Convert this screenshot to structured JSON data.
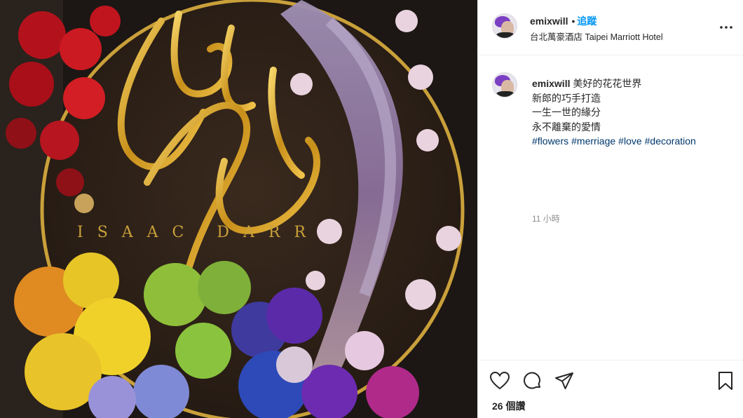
{
  "post": {
    "photo_sign_script": "Chen Chen",
    "photo_sign_caps": "ISAAC DARR"
  },
  "header": {
    "username": "emixwill",
    "separator": "•",
    "follow_label": "追蹤",
    "location": "台北萬豪酒店 Taipei Marriott Hotel"
  },
  "caption": {
    "username": "emixwill",
    "first_line": "美好的花花世界",
    "lines": [
      "新郎的巧手打造",
      "一生一世的緣分",
      "永不離棄的愛情"
    ],
    "hashtags": [
      "#flowers",
      "#merriage",
      "#love",
      "#decoration"
    ],
    "timestamp": "11 小時"
  },
  "actions": {
    "likes": "26 個讚"
  },
  "colors": {
    "link_blue": "#0095f6",
    "hashtag_blue": "#00376b",
    "gold": "#d4a21a"
  },
  "icons": [
    "more-options-icon",
    "heart-icon",
    "comment-icon",
    "share-icon",
    "bookmark-icon"
  ]
}
